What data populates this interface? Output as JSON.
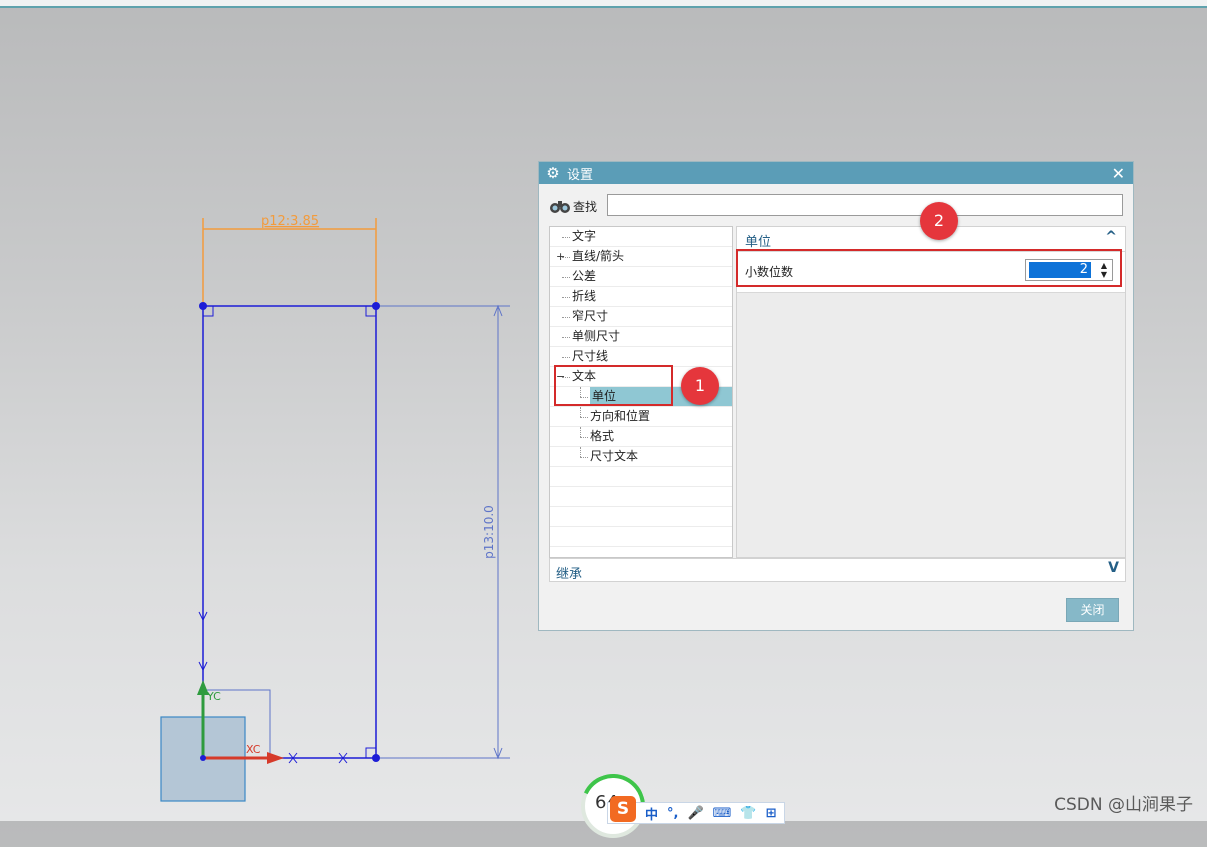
{
  "drawing": {
    "top_dimension": "p12:3.85",
    "right_dimension": "p13:10.0",
    "axis_y": "YC",
    "axis_x": "XC"
  },
  "dialog": {
    "title": "设置",
    "icon": "gear-icon",
    "close_glyph": "✕",
    "find_label": "查找",
    "find_value": "",
    "tree": [
      {
        "label": "文字"
      },
      {
        "label": "直线/箭头",
        "expander": "+"
      },
      {
        "label": "公差"
      },
      {
        "label": "折线"
      },
      {
        "label": "窄尺寸"
      },
      {
        "label": "单侧尺寸"
      },
      {
        "label": "尺寸线"
      },
      {
        "label": "文本",
        "expander": "−"
      },
      {
        "label": "单位",
        "child": true,
        "selected": true
      },
      {
        "label": "方向和位置",
        "child": true
      },
      {
        "label": "格式",
        "child": true
      },
      {
        "label": "尺寸文本",
        "child": true
      }
    ],
    "section_title": "单位",
    "section_collapse_glyph": "^",
    "decimal_label": "小数位数",
    "decimal_value": "2",
    "inherit_label": "继承",
    "inherit_expand_glyph": "V",
    "close_button": "关闭"
  },
  "annotations": {
    "badge_1": "1",
    "badge_2": "2",
    "red_color": "#e5363c"
  },
  "taskbar": {
    "speed_value": "64",
    "ime_logo": "S",
    "ime_items": [
      "中",
      "°,",
      "🎤",
      "⌨",
      "👕",
      "⊞"
    ]
  },
  "watermark": "CSDN @山涧果子",
  "colors": {
    "sketch_blue": "#1d1dd6",
    "dimension_orange": "#f39b3c",
    "dimension_blue": "#5e74c8",
    "dialog_title": "#5b9db7",
    "selection": "#8fc7d3"
  }
}
